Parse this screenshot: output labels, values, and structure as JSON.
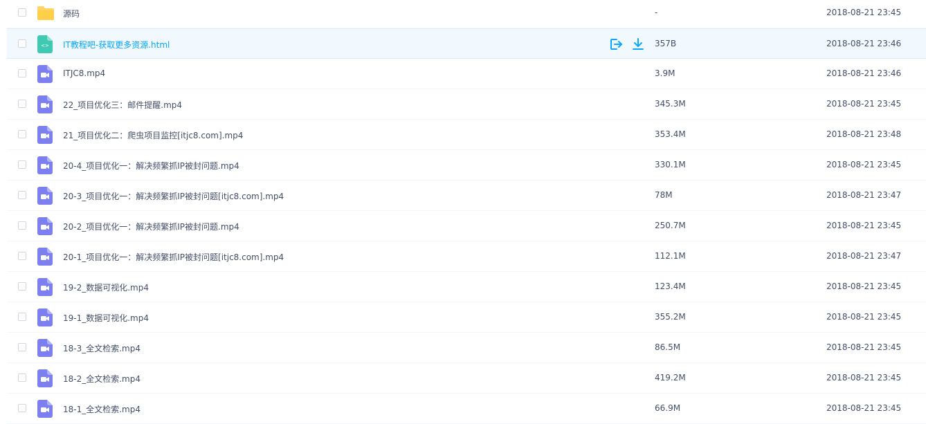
{
  "colors": {
    "folder": "#ffd460",
    "html_file": "#3fc8b2",
    "video_file": "#7c7ff0",
    "accent": "#06a7ff",
    "text": "#424e67"
  },
  "files": [
    {
      "name": "源码",
      "size": "-",
      "date": "2018-08-21 23:45",
      "icon": "folder-icon"
    },
    {
      "name": "IT教程吧-获取更多资源.html",
      "size": "357B",
      "date": "2018-08-21 23:46",
      "icon": "html-file-icon",
      "hovered": true
    },
    {
      "name": "ITJC8.mp4",
      "size": "3.9M",
      "date": "2018-08-21 23:46",
      "icon": "video-file-icon"
    },
    {
      "name": "22_项目优化三：邮件提醒.mp4",
      "size": "345.3M",
      "date": "2018-08-21 23:45",
      "icon": "video-file-icon"
    },
    {
      "name": "21_项目优化二：爬虫项目监控[itjc8.com].mp4",
      "size": "353.4M",
      "date": "2018-08-21 23:48",
      "icon": "video-file-icon"
    },
    {
      "name": "20-4_项目优化一：解决频繁抓IP被封问题.mp4",
      "size": "330.1M",
      "date": "2018-08-21 23:45",
      "icon": "video-file-icon"
    },
    {
      "name": "20-3_项目优化一：解决频繁抓IP被封问题[itjc8.com].mp4",
      "size": "78M",
      "date": "2018-08-21 23:47",
      "icon": "video-file-icon"
    },
    {
      "name": "20-2_项目优化一：解决频繁抓IP被封问题.mp4",
      "size": "250.7M",
      "date": "2018-08-21 23:45",
      "icon": "video-file-icon"
    },
    {
      "name": "20-1_项目优化一：解决频繁抓IP被封问题[itjc8.com].mp4",
      "size": "112.1M",
      "date": "2018-08-21 23:47",
      "icon": "video-file-icon"
    },
    {
      "name": "19-2_数据可视化.mp4",
      "size": "123.4M",
      "date": "2018-08-21 23:45",
      "icon": "video-file-icon"
    },
    {
      "name": "19-1_数据可视化.mp4",
      "size": "355.2M",
      "date": "2018-08-21 23:45",
      "icon": "video-file-icon"
    },
    {
      "name": "18-3_全文检索.mp4",
      "size": "86.5M",
      "date": "2018-08-21 23:45",
      "icon": "video-file-icon"
    },
    {
      "name": "18-2_全文检索.mp4",
      "size": "419.2M",
      "date": "2018-08-21 23:45",
      "icon": "video-file-icon"
    },
    {
      "name": "18-1_全文检索.mp4",
      "size": "66.9M",
      "date": "2018-08-21 23:45",
      "icon": "video-file-icon"
    }
  ],
  "row_actions": {
    "share_icon": "share-icon",
    "download_icon": "download-icon"
  }
}
